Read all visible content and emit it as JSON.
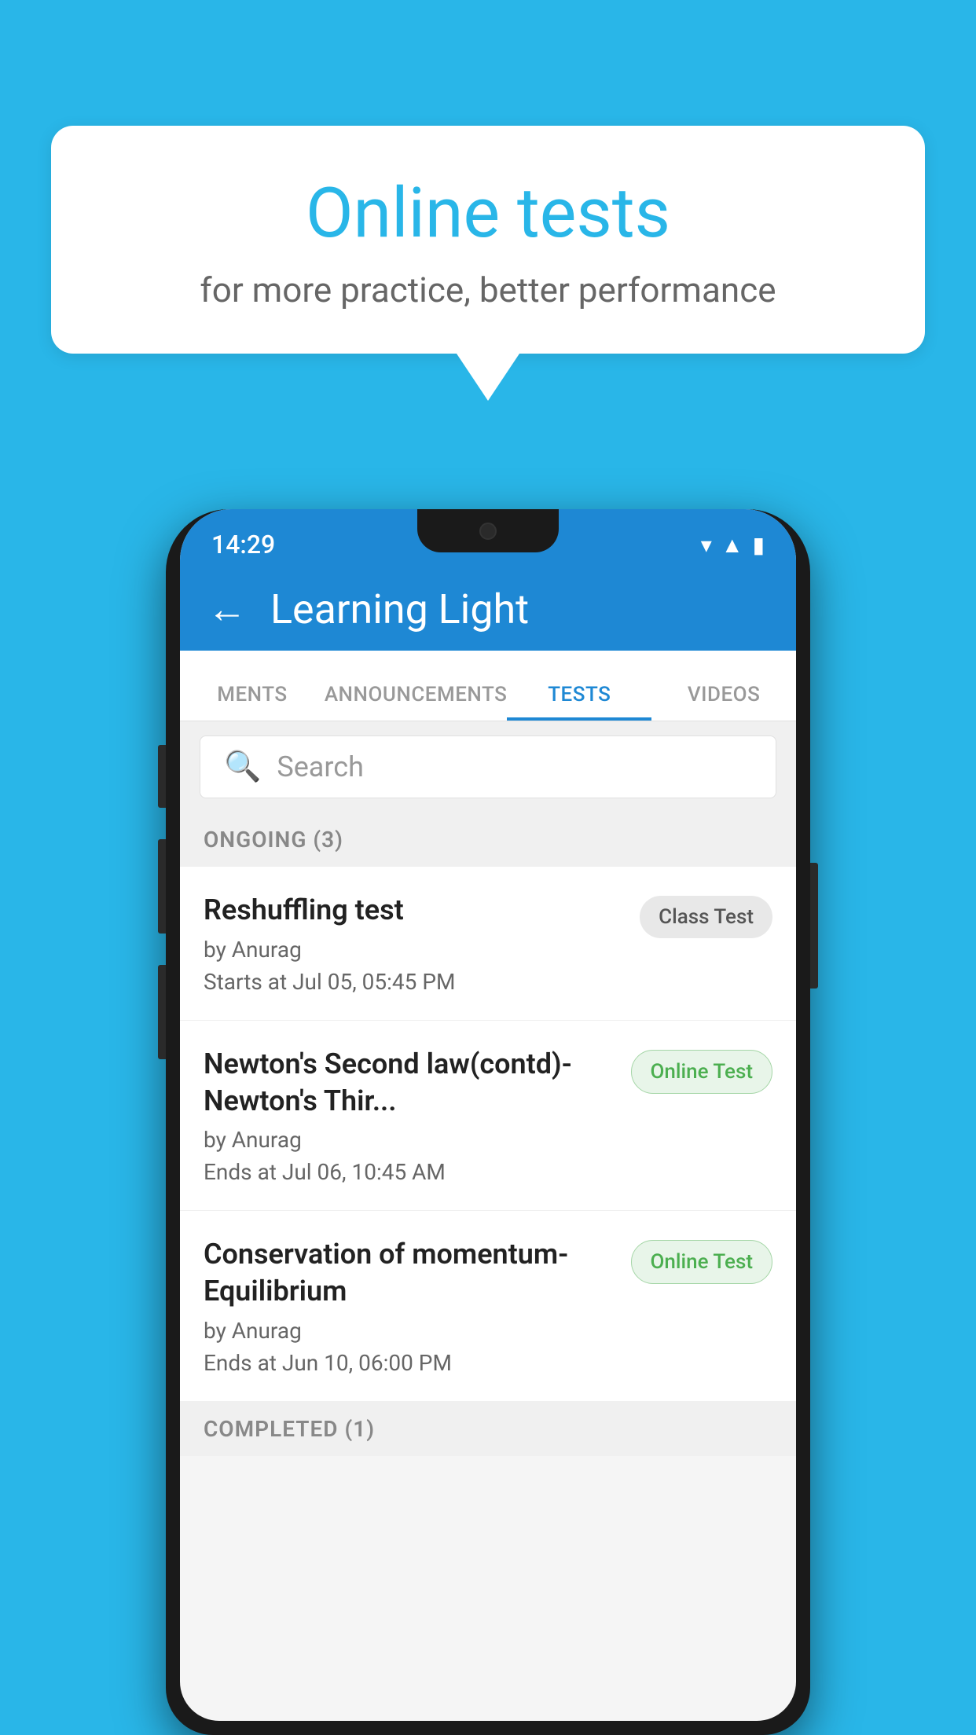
{
  "background_color": "#29B6E8",
  "speech_bubble": {
    "title": "Online tests",
    "subtitle": "for more practice, better performance"
  },
  "phone": {
    "status_bar": {
      "time": "14:29",
      "icons": [
        "wifi",
        "signal",
        "battery"
      ]
    },
    "header": {
      "back_label": "←",
      "title": "Learning Light"
    },
    "tabs": [
      {
        "label": "MENTS",
        "active": false
      },
      {
        "label": "ANNOUNCEMENTS",
        "active": false
      },
      {
        "label": "TESTS",
        "active": true
      },
      {
        "label": "VIDEOS",
        "active": false
      }
    ],
    "search": {
      "placeholder": "Search"
    },
    "ongoing_section": {
      "label": "ONGOING (3)"
    },
    "test_items": [
      {
        "name": "Reshuffling test",
        "author": "by Anurag",
        "date": "Starts at  Jul 05, 05:45 PM",
        "badge": "Class Test",
        "badge_type": "class"
      },
      {
        "name": "Newton's Second law(contd)-Newton's Thir...",
        "author": "by Anurag",
        "date": "Ends at  Jul 06, 10:45 AM",
        "badge": "Online Test",
        "badge_type": "online"
      },
      {
        "name": "Conservation of momentum-Equilibrium",
        "author": "by Anurag",
        "date": "Ends at  Jun 10, 06:00 PM",
        "badge": "Online Test",
        "badge_type": "online"
      }
    ],
    "completed_section": {
      "label": "COMPLETED (1)"
    }
  }
}
